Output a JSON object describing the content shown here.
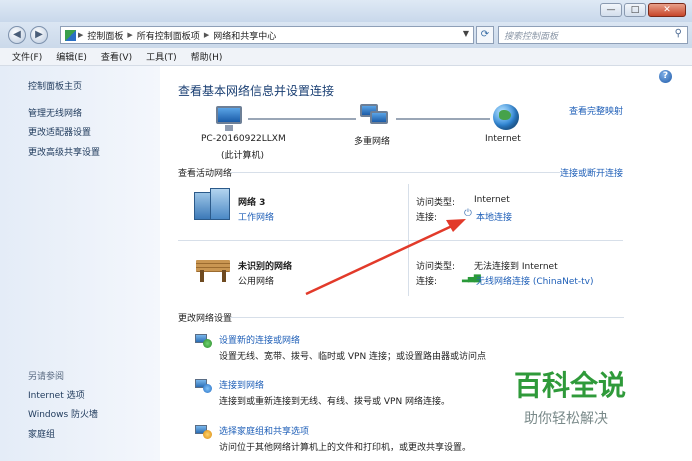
{
  "window": {
    "min": "—",
    "max": "□",
    "close": "✕"
  },
  "address": {
    "crumbs": [
      "控制面板",
      "所有控制面板项",
      "网络和共享中心"
    ],
    "search_placeholder": "搜索控制面板"
  },
  "menu": [
    "文件(F)",
    "编辑(E)",
    "查看(V)",
    "工具(T)",
    "帮助(H)"
  ],
  "sidebar": {
    "links": [
      "控制面板主页",
      "管理无线网络",
      "更改适配器设置",
      "更改高级共享设置"
    ],
    "see_also_title": "另请参阅",
    "see_also": [
      "Internet 选项",
      "Windows 防火墙",
      "家庭组"
    ]
  },
  "main": {
    "title": "查看基本网络信息并设置连接",
    "view_full_map": "查看完整映射",
    "map": {
      "pc_name": "PC-20160922LLXM",
      "pc_sub": "(此计算机)",
      "middle": "多重网络",
      "internet": "Internet"
    },
    "active_title": "查看活动网络",
    "connect_disconnect": "连接或断开连接",
    "networks": [
      {
        "name": "网络  3",
        "type": "工作网络",
        "access_label": "访问类型:",
        "access": "Internet",
        "conn_label": "连接:",
        "conn": "本地连接"
      },
      {
        "name": "未识别的网络",
        "type": "公用网络",
        "access_label": "访问类型:",
        "access": "无法连接到 Internet",
        "conn_label": "连接:",
        "conn": "无线网络连接 (ChinaNet-tv)"
      }
    ],
    "change_title": "更改网络设置",
    "settings": [
      {
        "title": "设置新的连接或网络",
        "desc": "设置无线、宽带、拨号、临时或 VPN 连接；或设置路由器或访问点"
      },
      {
        "title": "连接到网络",
        "desc": "连接到或重新连接到无线、有线、拨号或 VPN 网络连接。"
      },
      {
        "title": "选择家庭组和共享选项",
        "desc": "访问位于其他网络计算机上的文件和打印机，或更改共享设置。"
      }
    ]
  },
  "watermark": {
    "main": "百科全说",
    "sub": "助你轻松解决"
  },
  "colors": {
    "arrow": "#e23a2a",
    "link": "#2060b8",
    "watermark": "#2f9a3a"
  }
}
